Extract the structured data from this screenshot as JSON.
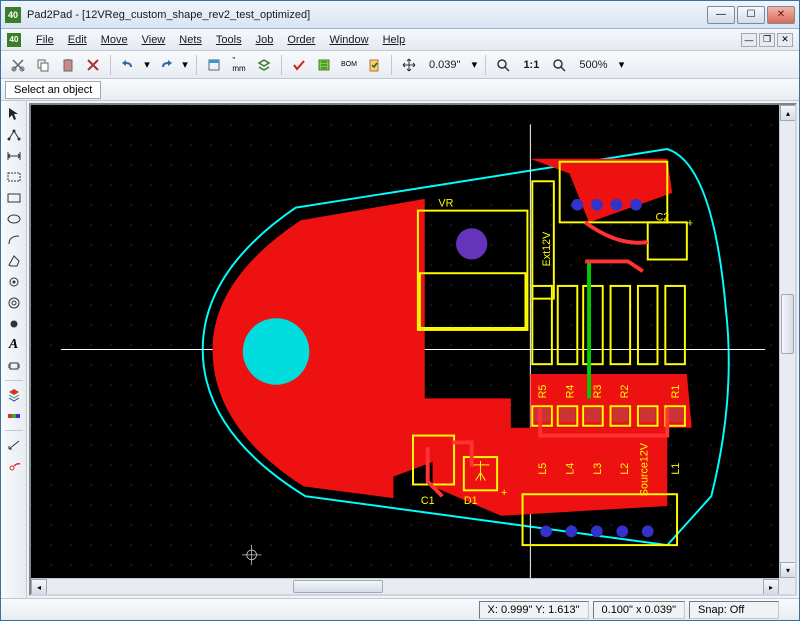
{
  "title": "Pad2Pad - [12VReg_custom_shape_rev2_test_optimized]",
  "menu": [
    "File",
    "Edit",
    "Move",
    "View",
    "Nets",
    "Tools",
    "Job",
    "Order",
    "Window",
    "Help"
  ],
  "toolbar": {
    "nudge": "0.039\"",
    "zoom_ratio": "1:1",
    "zoom_pct": "500%"
  },
  "hint": "Select an object",
  "pcb": {
    "ref_des": [
      "VR",
      "C1",
      "C2",
      "D1",
      "R1",
      "R2",
      "R3",
      "R4",
      "R5",
      "L1",
      "L2",
      "L3",
      "L4",
      "L5"
    ],
    "silkscreen_labels": [
      "Ext12V",
      "Source12V",
      "+",
      "+"
    ]
  },
  "status": {
    "coords": "X: 0.999\" Y: 1.613\"",
    "grid": "0.100\" x 0.039\"",
    "snap": "Snap: Off"
  }
}
